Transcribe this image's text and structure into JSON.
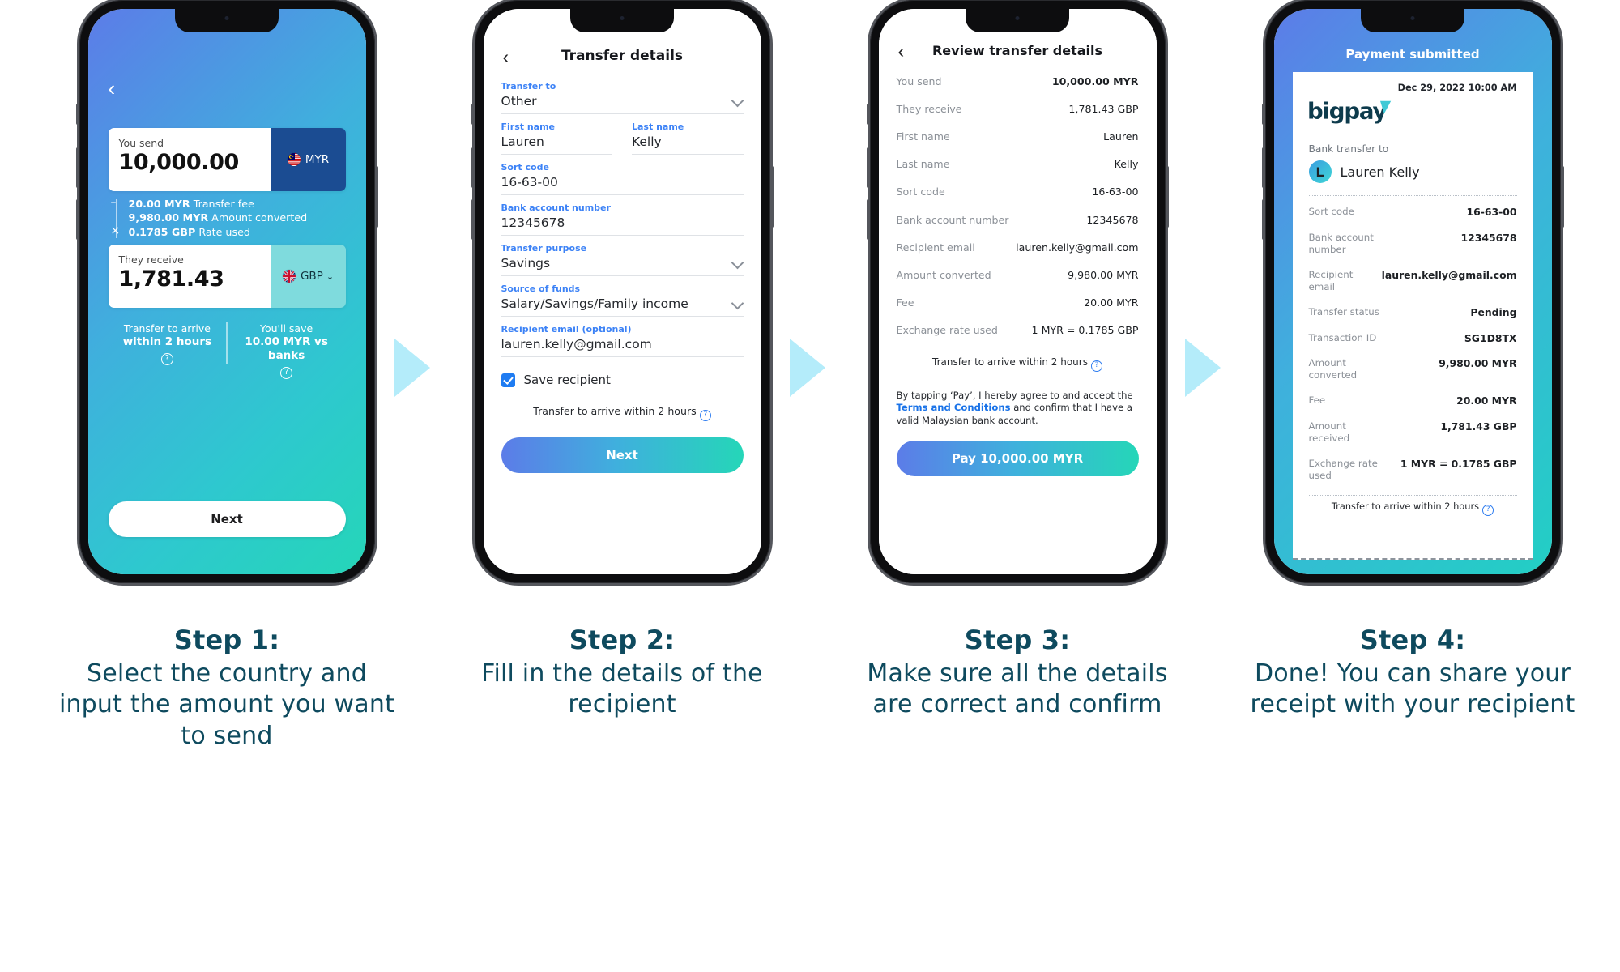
{
  "steps": [
    {
      "num": "Step 1:",
      "text": "Select the country and input the amount you want to send"
    },
    {
      "num": "Step 2:",
      "text": "Fill in the details of the recipient"
    },
    {
      "num": "Step 3:",
      "text": "Make sure all the details are correct and confirm"
    },
    {
      "num": "Step 4:",
      "text": "Done! You can share your receipt with your recipient"
    }
  ],
  "screen1": {
    "back_icon": "‹",
    "send_label": "You send",
    "send_amount": "10,000.00",
    "send_currency": "MYR",
    "breakdown": [
      {
        "op": "–",
        "value": "20.00 MYR",
        "label": "Transfer fee"
      },
      {
        "op": "",
        "value": "9,980.00 MYR",
        "label": "Amount converted"
      },
      {
        "op": "×",
        "value": "0.1785 GBP",
        "label": "Rate used"
      }
    ],
    "receive_label": "They receive",
    "receive_amount": "1,781.43",
    "receive_currency": "GBP",
    "foot_left_top": "Transfer to arrive",
    "foot_left_bold": "within 2 hours",
    "foot_right_top": "You'll save",
    "foot_right_bold": "10.00 MYR vs banks",
    "help_icon": "?",
    "next_label": "Next"
  },
  "screen2": {
    "title": "Transfer details",
    "back_icon": "‹",
    "fields": [
      {
        "label": "Transfer to",
        "value": "Other",
        "chevron": true
      },
      {
        "label": "First name",
        "value": "Lauren",
        "chevron": false
      },
      {
        "label": "Last name",
        "value": "Kelly",
        "chevron": false
      },
      {
        "label": "Sort code",
        "value": "16-63-00",
        "chevron": false
      },
      {
        "label": "Bank account number",
        "value": "12345678",
        "chevron": false
      },
      {
        "label": "Transfer purpose",
        "value": "Savings",
        "chevron": true
      },
      {
        "label": "Source of funds",
        "value": "Salary/Savings/Family income",
        "chevron": true
      },
      {
        "label": "Recipient email (optional)",
        "value": "lauren.kelly@gmail.com",
        "chevron": false
      }
    ],
    "save_recipient_label": "Save recipient",
    "save_recipient_checked": true,
    "eta": "Transfer to arrive within 2 hours",
    "help_icon": "?",
    "next_label": "Next"
  },
  "screen3": {
    "title": "Review transfer details",
    "back_icon": "‹",
    "rows": [
      {
        "key": "You send",
        "value": "10,000.00 MYR",
        "bold": true
      },
      {
        "key": "They receive",
        "value": "1,781.43 GBP",
        "bold": false
      },
      {
        "key": "First name",
        "value": "Lauren",
        "bold": false
      },
      {
        "key": "Last name",
        "value": "Kelly",
        "bold": false
      },
      {
        "key": "Sort code",
        "value": "16-63-00",
        "bold": false
      },
      {
        "key": "Bank account number",
        "value": "12345678",
        "bold": false
      },
      {
        "key": "Recipient email",
        "value": "lauren.kelly@gmail.com",
        "bold": false
      },
      {
        "key": "Amount converted",
        "value": "9,980.00 MYR",
        "bold": false
      },
      {
        "key": "Fee",
        "value": "20.00 MYR",
        "bold": false
      },
      {
        "key": "Exchange rate used",
        "value": "1 MYR = 0.1785 GBP",
        "bold": false
      }
    ],
    "eta": "Transfer to arrive within 2 hours",
    "help_icon": "?",
    "terms_pre": "By tapping ‘Pay’, I hereby agree to and accept the ",
    "terms_link": "Terms and Conditions",
    "terms_post": " and confirm that I have a valid Malaysian bank account.",
    "pay_label": "Pay 10,000.00 MYR"
  },
  "screen4": {
    "title": "Payment submitted",
    "date": "Dec 29, 2022 10:00 AM",
    "brand": "bigpay",
    "subtitle": "Bank transfer to",
    "avatar_initial": "L",
    "recipient_name": "Lauren Kelly",
    "rows": [
      {
        "key": "Sort code",
        "value": "16-63-00"
      },
      {
        "key": "Bank account number",
        "value": "12345678"
      },
      {
        "key": "Recipient email",
        "value": "lauren.kelly@gmail.com"
      },
      {
        "key": "Transfer status",
        "value": "Pending"
      },
      {
        "key": "Transaction ID",
        "value": "SG1D8TX"
      },
      {
        "key": "Amount converted",
        "value": "9,980.00 MYR"
      },
      {
        "key": "Fee",
        "value": "20.00 MYR"
      },
      {
        "key": "Amount received",
        "value": "1,781.43 GBP"
      },
      {
        "key": "Exchange rate used",
        "value": "1 MYR = 0.1785 GBP"
      }
    ],
    "eta": "Transfer to arrive within 2 hours",
    "help_icon": "?"
  },
  "colors": {
    "caption": "#0e4a5e",
    "arrow": "#b4ecfa",
    "accent_blue": "#3c82f6",
    "gradient_start": "#5c7ce8",
    "gradient_end": "#25d6b8",
    "myr_chip": "#1b4c92",
    "gbp_chip": "#7fdbdd"
  }
}
